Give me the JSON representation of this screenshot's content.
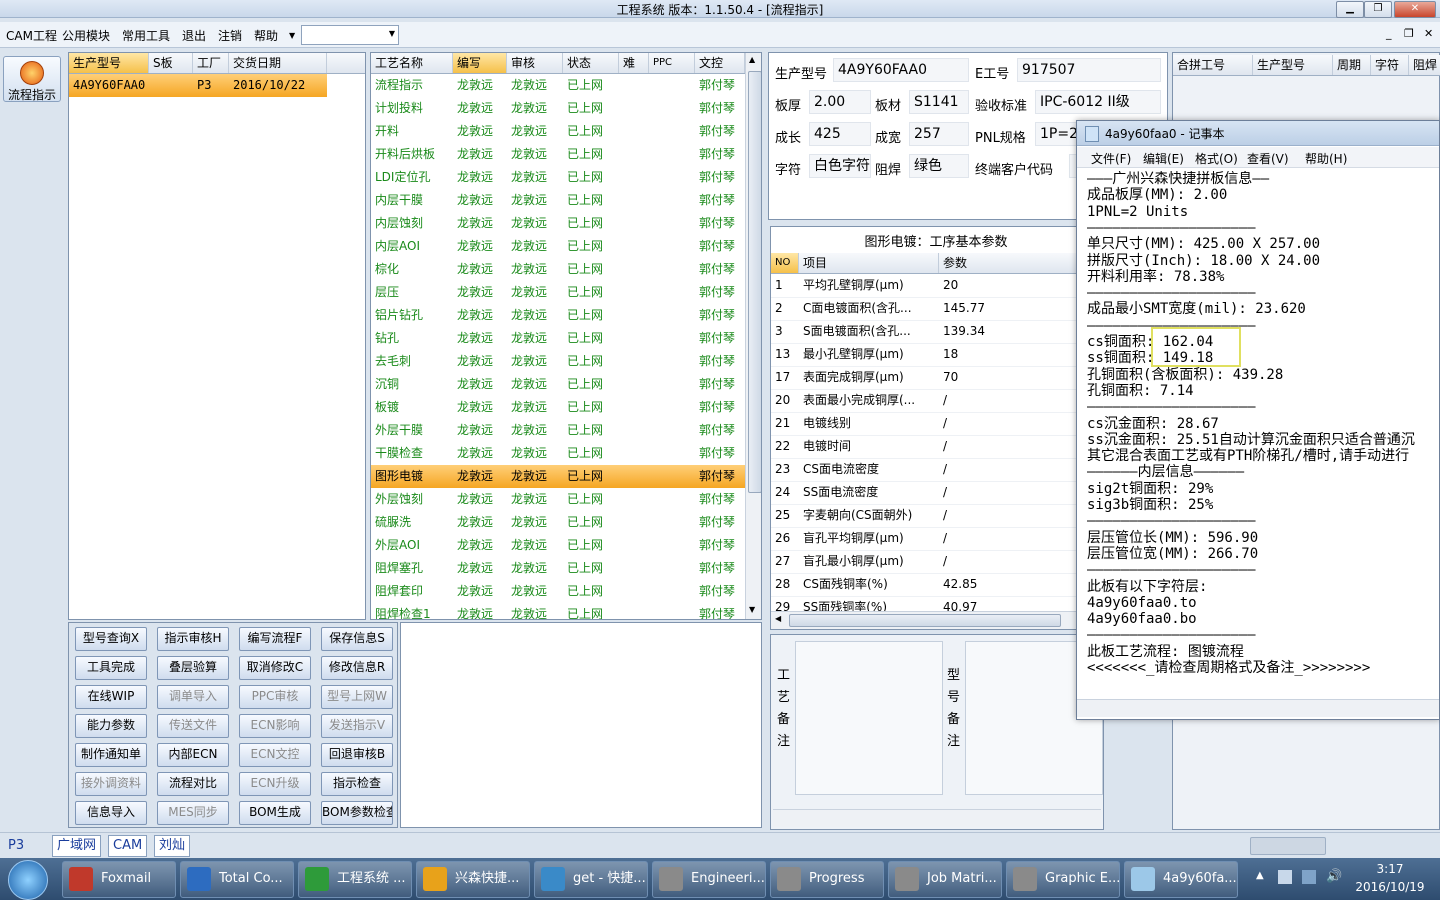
{
  "window": {
    "title": "工程系统   版本：1.1.50.4 - [流程指示]"
  },
  "menu": [
    "CAM工程",
    "公用模块",
    "常用工具",
    "退出",
    "注销",
    "帮助"
  ],
  "rail": {
    "label": "流程指示"
  },
  "model_list": {
    "headers": [
      "生产型号",
      "S板",
      "工厂",
      "交货日期"
    ],
    "rows": [
      [
        "4A9Y60FAA0",
        "",
        "P3",
        "2016/10/22"
      ]
    ]
  },
  "process": {
    "headers": [
      "工艺名称",
      "编写",
      "审核",
      "状态",
      "难",
      "PPC",
      "文控"
    ],
    "rows": [
      [
        "流程指示",
        "龙敦远",
        "龙敦远",
        "已上网",
        "",
        "",
        "郭付琴"
      ],
      [
        "计划投料",
        "龙敦远",
        "龙敦远",
        "已上网",
        "",
        "",
        "郭付琴"
      ],
      [
        "开料",
        "龙敦远",
        "龙敦远",
        "已上网",
        "",
        "",
        "郭付琴"
      ],
      [
        "开料后烘板",
        "龙敦远",
        "龙敦远",
        "已上网",
        "",
        "",
        "郭付琴"
      ],
      [
        "LDI定位孔",
        "龙敦远",
        "龙敦远",
        "已上网",
        "",
        "",
        "郭付琴"
      ],
      [
        "内层干膜",
        "龙敦远",
        "龙敦远",
        "已上网",
        "",
        "",
        "郭付琴"
      ],
      [
        "内层蚀刻",
        "龙敦远",
        "龙敦远",
        "已上网",
        "",
        "",
        "郭付琴"
      ],
      [
        "内层AOI",
        "龙敦远",
        "龙敦远",
        "已上网",
        "",
        "",
        "郭付琴"
      ],
      [
        "棕化",
        "龙敦远",
        "龙敦远",
        "已上网",
        "",
        "",
        "郭付琴"
      ],
      [
        "层压",
        "龙敦远",
        "龙敦远",
        "已上网",
        "",
        "",
        "郭付琴"
      ],
      [
        "铝片钻孔",
        "龙敦远",
        "龙敦远",
        "已上网",
        "",
        "",
        "郭付琴"
      ],
      [
        "钻孔",
        "龙敦远",
        "龙敦远",
        "已上网",
        "",
        "",
        "郭付琴"
      ],
      [
        "去毛刺",
        "龙敦远",
        "龙敦远",
        "已上网",
        "",
        "",
        "郭付琴"
      ],
      [
        "沉铜",
        "龙敦远",
        "龙敦远",
        "已上网",
        "",
        "",
        "郭付琴"
      ],
      [
        "板镀",
        "龙敦远",
        "龙敦远",
        "已上网",
        "",
        "",
        "郭付琴"
      ],
      [
        "外层干膜",
        "龙敦远",
        "龙敦远",
        "已上网",
        "",
        "",
        "郭付琴"
      ],
      [
        "干膜检查",
        "龙敦远",
        "龙敦远",
        "已上网",
        "",
        "",
        "郭付琴"
      ],
      [
        "图形电镀",
        "龙敦远",
        "龙敦远",
        "已上网",
        "",
        "",
        "郭付琴"
      ],
      [
        "外层蚀刻",
        "龙敦远",
        "龙敦远",
        "已上网",
        "",
        "",
        "郭付琴"
      ],
      [
        "硫脲洗",
        "龙敦远",
        "龙敦远",
        "已上网",
        "",
        "",
        "郭付琴"
      ],
      [
        "外层AOI",
        "龙敦远",
        "龙敦远",
        "已上网",
        "",
        "",
        "郭付琴"
      ],
      [
        "阻焊塞孔",
        "龙敦远",
        "龙敦远",
        "已上网",
        "",
        "",
        "郭付琴"
      ],
      [
        "阻焊套印",
        "龙敦远",
        "龙敦远",
        "已上网",
        "",
        "",
        "郭付琴"
      ],
      [
        "阻焊检查1",
        "龙敦远",
        "龙敦远",
        "已上网",
        "",
        "",
        "郭付琴"
      ]
    ],
    "selected_index": 17
  },
  "buttons": [
    [
      "型号查询X",
      "指示审核H",
      "编写流程F",
      "保存信息S"
    ],
    [
      "工具完成",
      "叠层验算",
      "取消修改C",
      "修改信息R"
    ],
    [
      "在线WIP",
      "调单导入",
      "PPC审核",
      "型号上网W"
    ],
    [
      "能力参数",
      "传送文件",
      "ECN影响",
      "发送指示V"
    ],
    [
      "制作通知单",
      "内部ECN",
      "ECN文控",
      "回退审核B"
    ],
    [
      "接外调资料",
      "流程对比",
      "ECN升级",
      "指示检查"
    ],
    [
      "信息导入",
      "MES同步",
      "BOM生成",
      "BOM参数检查"
    ]
  ],
  "disabled_buttons": [
    "调单导入",
    "PPC审核",
    "型号上网W",
    "传送文件",
    "ECN影响",
    "发送指示V",
    "ECN文控",
    "接外调资料",
    "ECN升级",
    "MES同步"
  ],
  "info": {
    "model_label": "生产型号",
    "model_value": "4A9Y60FAA0",
    "eno_label": "E工号",
    "eno_value": "917507",
    "thick_label": "板厚",
    "thick_value": "2.00",
    "mat_label": "板材",
    "mat_value": "S1141",
    "std_label": "验收标准",
    "std_value": "IPC-6012 II级",
    "len_label": "成长",
    "len_value": "425",
    "wid_label": "成宽",
    "wid_value": "257",
    "pnl_label": "PNL规格",
    "pnl_value": "1P=2",
    "char_label": "字符",
    "char_value": "白色字符",
    "mask_label": "阻焊",
    "mask_value": "绿色",
    "cust_label": "终端客户代码"
  },
  "params": {
    "title": "图形电镀：工序基本参数",
    "headers": [
      "NO",
      "项目",
      "参数"
    ],
    "rows": [
      [
        "1",
        "平均孔壁铜厚(μm)",
        "20"
      ],
      [
        "2",
        "C面电镀面积(含孔...",
        "145.77"
      ],
      [
        "3",
        "S面电镀面积(含孔...",
        "139.34"
      ],
      [
        "13",
        "最小孔壁铜厚(μm)",
        "18"
      ],
      [
        "17",
        "表面完成铜厚(μm)",
        "70"
      ],
      [
        "20",
        "表面最小完成铜厚(...",
        "/"
      ],
      [
        "21",
        "电镀线别",
        "/"
      ],
      [
        "22",
        "电镀时间",
        "/"
      ],
      [
        "23",
        "CS面电流密度",
        "/"
      ],
      [
        "24",
        "SS面电流密度",
        "/"
      ],
      [
        "25",
        "字麦朝向(CS面朝外)",
        "/"
      ],
      [
        "26",
        "盲孔平均铜厚(μm)",
        "/"
      ],
      [
        "27",
        "盲孔最小铜厚(μm)",
        "/"
      ],
      [
        "28",
        "CS面残铜率(%)",
        "42.85"
      ],
      [
        "29",
        "SS面残铜率(%)",
        "40.97"
      ]
    ]
  },
  "notes": {
    "process_label": "工艺备注",
    "model_label": "型号备注"
  },
  "combine": {
    "headers": [
      "合拼工号",
      "生产型号",
      "周期",
      "字符",
      "阻焊"
    ]
  },
  "notepad": {
    "title": "4a9y60faa0 - 记事本",
    "menu": [
      "文件(F)",
      "编辑(E)",
      "格式(O)",
      "查看(V)",
      "帮助(H)"
    ],
    "lines": [
      "———广州兴森快捷拼板信息——",
      "成品板厚(MM): 2.00",
      "1PNL=2 Units",
      "————————————————————",
      "单只尺寸(MM): 425.00 X 257.00",
      "拼版尺寸(Inch): 18.00 X 24.00",
      "开料利用率: 78.38%",
      "————————————————————",
      "成品最小SMT宽度(mil): 23.620",
      "————————————————————",
      "cs铜面积: 162.04",
      "ss铜面积: 149.18",
      "孔铜面积(含板面积): 439.28",
      "孔铜面积: 7.14",
      "————————————————————",
      "cs沉金面积: 28.67",
      "ss沉金面积: 25.51自动计算沉金面积只适合普通沉",
      "其它混合表面工艺或有PTH阶梯孔/槽时,请手动进行",
      "——————内层信息——————",
      "sig2t铜面积: 29%",
      "sig3b铜面积: 25%",
      "————————————————————",
      "层压管位长(MM): 596.90",
      "层压管位宽(MM): 266.70",
      "————————————————————",
      "此板有以下字符层:",
      "4a9y60faa0.to",
      "4a9y60faa0.bo",
      "————————————————————",
      "此板工艺流程: 图镀流程",
      "<<<<<<<_请检查周期格式及备注_>>>>>>>>"
    ]
  },
  "status": {
    "factory": "P3",
    "tabs": [
      "广域网",
      "CAM",
      "刘灿"
    ]
  },
  "taskbar": {
    "items": [
      "Foxmail",
      "Total Co...",
      "工程系统 ...",
      "兴森快捷...",
      "get - 快捷...",
      "Engineeri...",
      "Progress",
      "Job Matri...",
      "Graphic E...",
      "4a9y60fa..."
    ],
    "time": "3:17",
    "date": "2016/10/19"
  },
  "colors": {
    "accent": "#f5a623",
    "green_text": "#1a8a1a",
    "highlight_box": "#e0e060"
  }
}
